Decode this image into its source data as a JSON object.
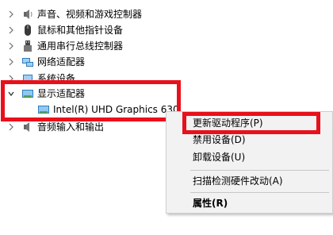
{
  "tree": {
    "items": [
      {
        "label": "声音、视频和游戏控制器",
        "icon": "speaker-icon"
      },
      {
        "label": "鼠标和其他指针设备",
        "icon": "mouse-icon"
      },
      {
        "label": "通用串行总线控制器",
        "icon": "usb-icon"
      },
      {
        "label": "网络适配器",
        "icon": "network-adapter-icon"
      },
      {
        "label": "系统设备",
        "icon": "system-device-icon"
      },
      {
        "label": "显示适配器",
        "icon": "display-adapter-icon"
      },
      {
        "label": "Intel(R) UHD Graphics 630",
        "icon": "gpu-icon"
      },
      {
        "label": "音频输入和输出",
        "icon": "audio-io-icon"
      }
    ]
  },
  "context_menu": {
    "update_driver": "更新驱动程序(P)",
    "disable_device": "禁用设备(D)",
    "uninstall_device": "卸载设备(U)",
    "scan_hardware": "扫描检测硬件改动(A)",
    "properties": "属性(R)"
  },
  "colors": {
    "highlight_red": "#e8101b",
    "menu_background": "#f2f2f2"
  }
}
